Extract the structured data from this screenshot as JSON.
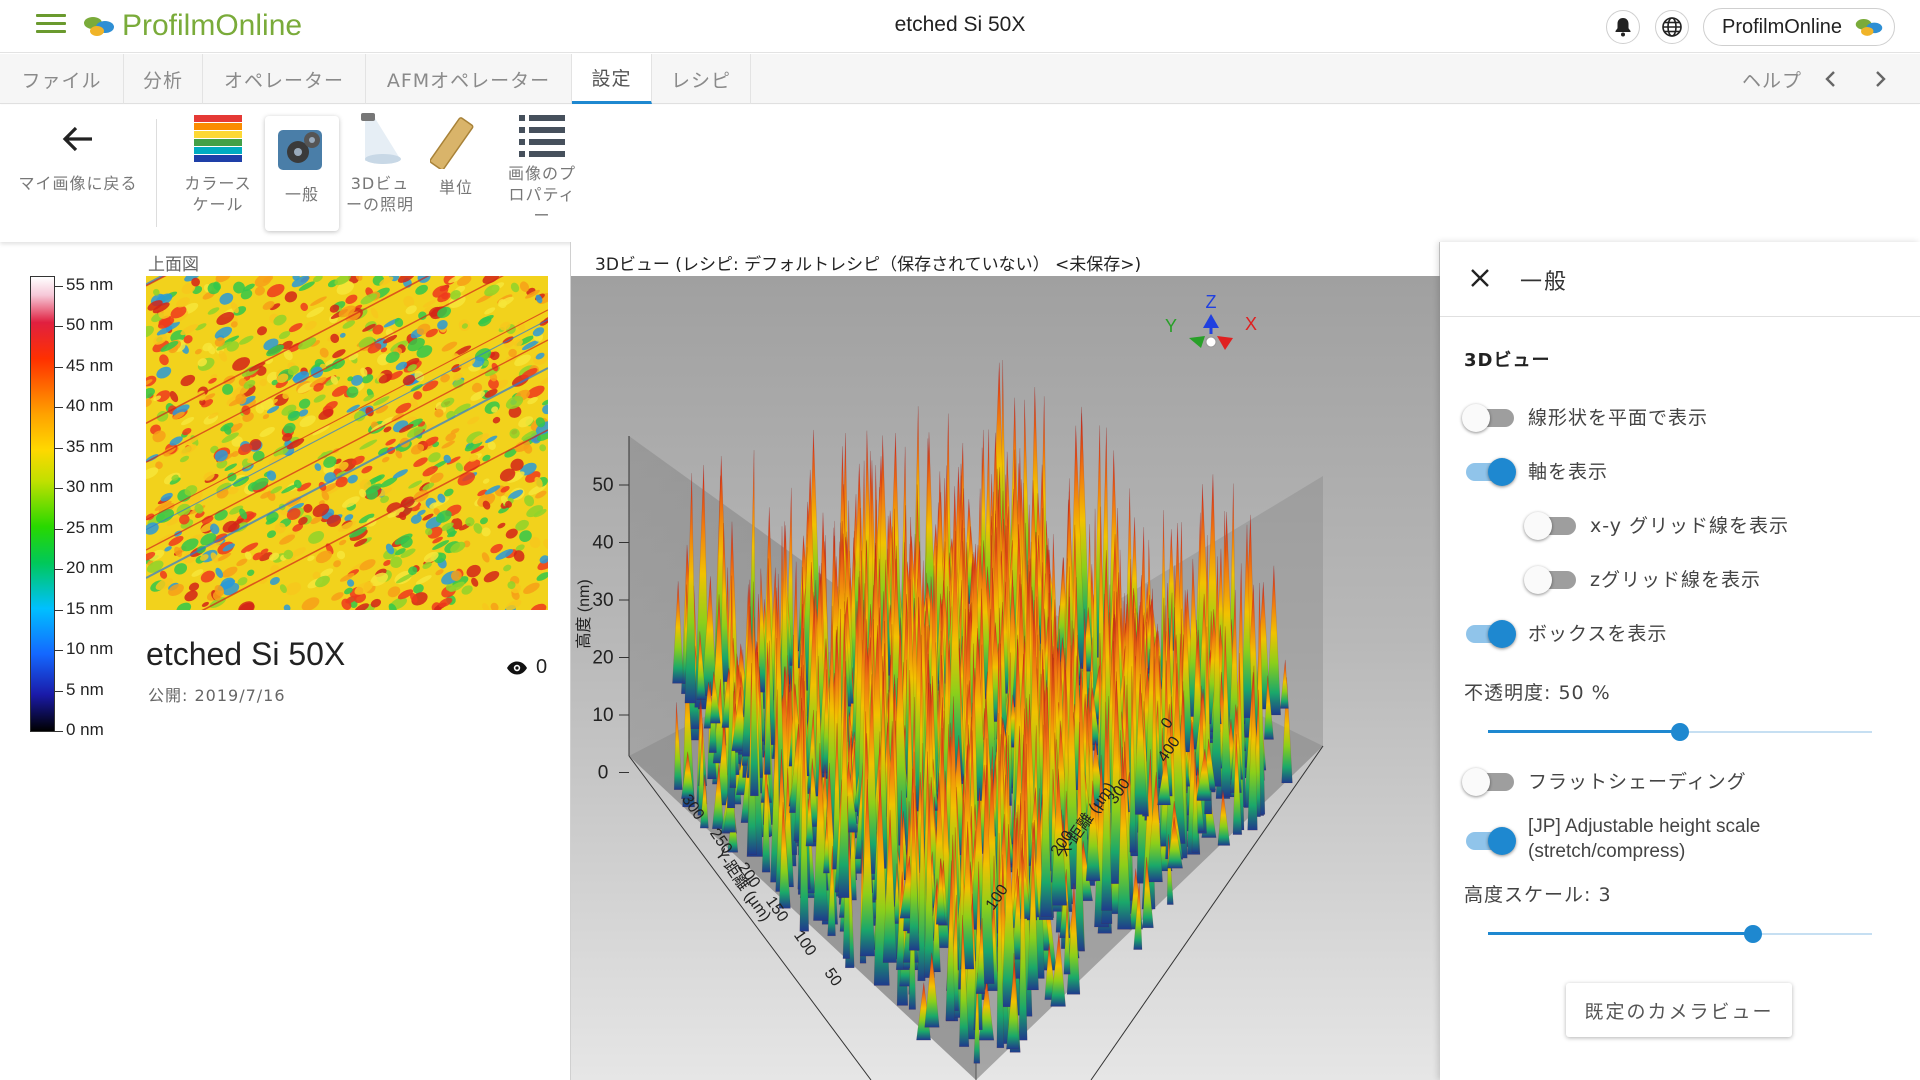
{
  "app": {
    "logo_text": "ProfilmOnline",
    "title": "etched Si 50X",
    "user_label": "ProfilmOnline"
  },
  "tabs": [
    {
      "label": "ファイル"
    },
    {
      "label": "分析"
    },
    {
      "label": "オペレーター"
    },
    {
      "label": "AFMオペレーター"
    },
    {
      "label": "設定",
      "active": true
    },
    {
      "label": "レシピ"
    }
  ],
  "help_label": "ヘルプ",
  "ribbon": {
    "back_label": "マイ画像に戻る",
    "color_scale_label": "カラースケール",
    "general_label": "一般",
    "lighting_label": "3Dビューの照明",
    "units_label": "単位",
    "image_props_label": "画像のプロパティー"
  },
  "left": {
    "topview_label": "上面図",
    "colorbar_labels": [
      "55 nm",
      "50 nm",
      "45 nm",
      "40 nm",
      "35 nm",
      "30 nm",
      "25 nm",
      "20 nm",
      "15 nm",
      "10 nm",
      "5 nm",
      "0 nm"
    ],
    "image_title": "etched Si 50X",
    "published": "公開: 2019/7/16",
    "view_count": "0"
  },
  "view3d": {
    "header": "3Dビュー (レシピ: デフォルトレシピ（保存されていない） <未保存>)",
    "z_axis_label": "高度 (nm)",
    "z_ticks": [
      "50",
      "40",
      "30",
      "20",
      "10",
      "0"
    ],
    "y_axis_label": "Y-距離 (µm)",
    "y_ticks": [
      "300",
      "250",
      "200",
      "150",
      "100",
      "50"
    ],
    "x_axis_label": "X-距離 (µm)",
    "x_ticks": [
      "0",
      "400",
      "300",
      "200",
      "100"
    ],
    "gizmo": {
      "x": "X",
      "y": "Y",
      "z": "Z"
    }
  },
  "panel": {
    "title": "一般",
    "section": "3Dビュー",
    "toggles": [
      {
        "label": "線形状を平面で表示",
        "on": false
      },
      {
        "label": "軸を表示",
        "on": true
      },
      {
        "label": "x-y グリッド線を表示",
        "on": false
      },
      {
        "label": "zグリッド線を表示",
        "on": false
      },
      {
        "label": "ボックスを表示",
        "on": true
      },
      {
        "label": "フラットシェーディング",
        "on": false
      },
      {
        "label": "[JP] Adjustable height scale (stretch/compress)",
        "on": true
      }
    ],
    "opacity_label": "不透明度: 50 %",
    "opacity_value": 0.5,
    "height_scale_label": "高度スケール: 3",
    "height_scale_value": 0.69,
    "default_camera_button": "既定のカメラビュー"
  },
  "colors": {
    "accent": "#1e88d0",
    "brand_green": "#7aab3a"
  }
}
